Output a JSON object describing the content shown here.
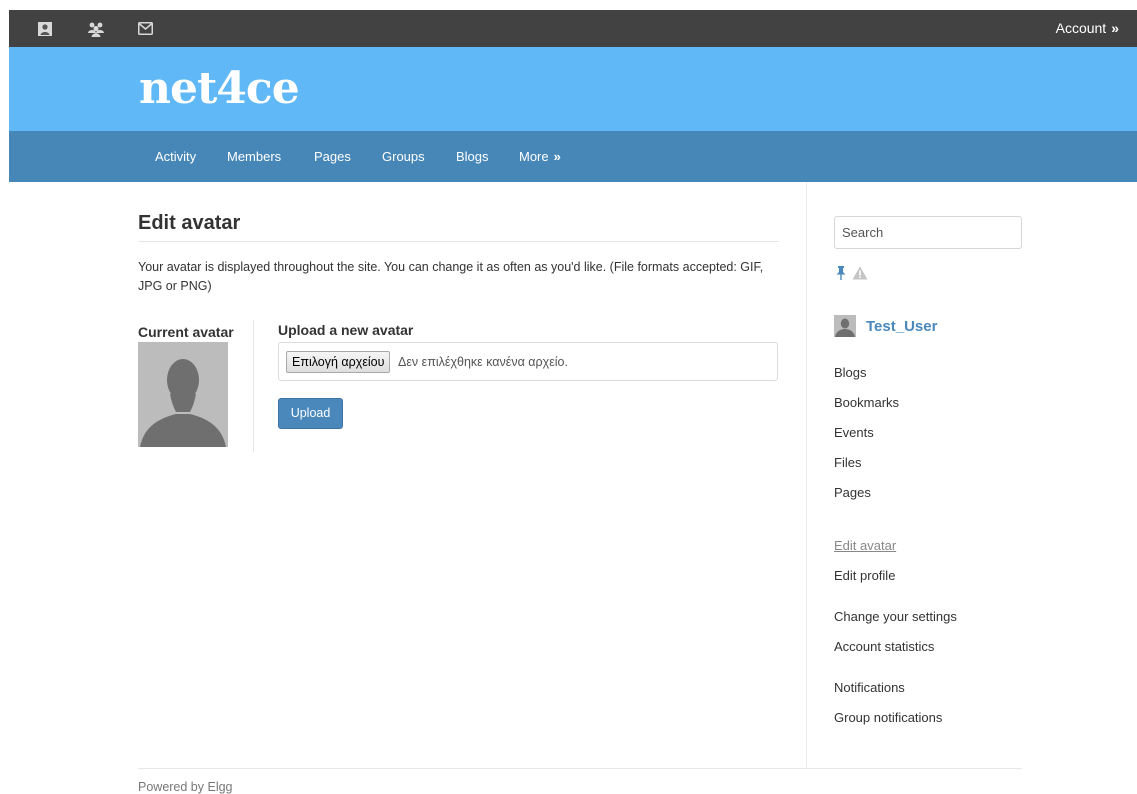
{
  "topbar": {
    "icons": [
      "profile-icon",
      "groups-icon",
      "messages-icon"
    ],
    "account_label": "Account",
    "account_arrow": "»"
  },
  "site": {
    "name": "net4ce"
  },
  "nav": {
    "items": [
      "Activity",
      "Members",
      "Pages",
      "Groups",
      "Blogs"
    ],
    "more_label": "More",
    "more_arrow": "»"
  },
  "main": {
    "title": "Edit avatar",
    "intro": "Your avatar is displayed throughout the site. You can change it as often as you'd like. (File formats accepted: GIF, JPG or PNG)",
    "current_avatar_label": "Current avatar",
    "upload_label": "Upload a new avatar",
    "file_button_label": "Επιλογή αρχείου",
    "file_status": "Δεν επιλέχθηκε κανένα αρχείο.",
    "upload_button": "Upload"
  },
  "sidebar": {
    "search_placeholder": "Search",
    "icons": [
      "pin-icon",
      "warning-icon"
    ],
    "owner_name": "Test_User",
    "tools": [
      "Blogs",
      "Bookmarks",
      "Events",
      "Files",
      "Pages"
    ],
    "settings_links": [
      "Edit avatar",
      "Edit profile",
      "Change your settings",
      "Account statistics",
      "Notifications",
      "Group notifications"
    ],
    "selected_link": "Edit avatar"
  },
  "footer": {
    "text": "Powered by Elgg"
  },
  "colors": {
    "topbar": "#424242",
    "header": "#60b8f7",
    "navbar": "#4787b8",
    "button": "#4a88bc",
    "link": "#4a88bc"
  }
}
